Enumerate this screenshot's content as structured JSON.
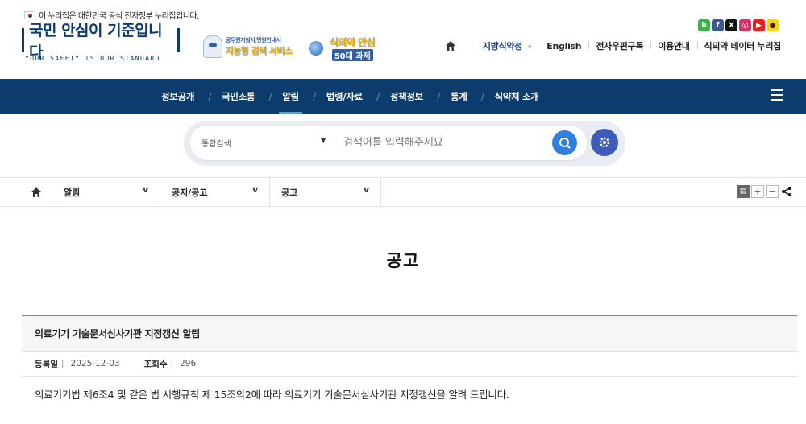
{
  "gov_banner": "이 누리집은 대한민국 공식 전자정부 누리집입니다.",
  "logo": {
    "title": "국민 안심이 기준입니다",
    "subtitle": "YOUR SAFETY IS OUR STANDARD"
  },
  "promo": {
    "banner1_line1": "공무원지침서/민원안내서",
    "banner1_line2": "지능형 검색 서비스",
    "banner2_line1": "식의약 안심",
    "banner2_line2": "50대 과제"
  },
  "sns": [
    {
      "name": "blog",
      "label": "b",
      "color": "#3cb14a"
    },
    {
      "name": "facebook",
      "label": "f",
      "color": "#3b5998"
    },
    {
      "name": "x",
      "label": "X",
      "color": "#111111"
    },
    {
      "name": "instagram",
      "label": "◎",
      "color": "#d6336c"
    },
    {
      "name": "youtube",
      "label": "▶",
      "color": "#e62117"
    },
    {
      "name": "kakao",
      "label": "●",
      "color": "#f7d900"
    }
  ],
  "util_nav": {
    "region": "지방식약청",
    "english": "English",
    "newsletter": "전자우편구독",
    "guide": "이용안내",
    "data": "식의약 데이터 누리집"
  },
  "gnb": {
    "items": [
      "정보공개",
      "국민소통",
      "알림",
      "법령/자료",
      "정책정보",
      "통계",
      "식약처 소개"
    ],
    "active": "알림"
  },
  "search": {
    "scope": "통합검색",
    "placeholder": "검색어를 입력해주세요",
    "value": ""
  },
  "breadcrumb": [
    "알림",
    "공지/공고",
    "공고"
  ],
  "page_title": "공고",
  "post": {
    "title": "의료기기 기술문서심사기관 지정갱신 알림",
    "date_label": "등록일",
    "date": "2025-12-03",
    "views_label": "조회수",
    "views": "296",
    "body": "의료기기법 제6조4 및 같은 법 시행규칙 제 15조의2에 따라 의료기기 기술문서심사기관 지정갱신을 알려 드립니다."
  },
  "colors": {
    "gnb_bg": "#0b3c6c",
    "accent": "#2fb3ea",
    "search_btn": "#2f7fe1"
  }
}
